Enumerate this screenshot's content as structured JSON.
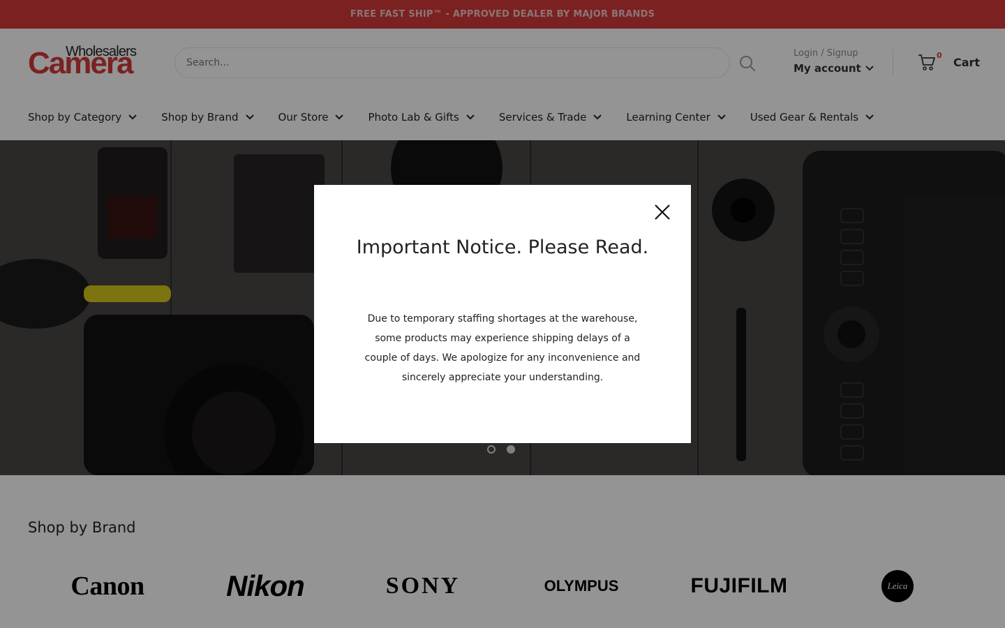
{
  "announcement": {
    "text": "FREE FAST SHIP™ - APPROVED DEALER BY MAJOR BRANDS"
  },
  "logo": {
    "top_text": "Wholesalers",
    "main_text": "Camera"
  },
  "search": {
    "placeholder": "Search..."
  },
  "account": {
    "login_label": "Login / Signup",
    "account_label": "My account"
  },
  "cart": {
    "count": "0",
    "label": "Cart"
  },
  "nav": {
    "items": [
      {
        "label": "Shop by Category"
      },
      {
        "label": "Shop by Brand"
      },
      {
        "label": "Our Store"
      },
      {
        "label": "Photo Lab & Gifts"
      },
      {
        "label": "Services & Trade"
      },
      {
        "label": "Learning Center"
      },
      {
        "label": "Used Gear & Rentals"
      }
    ]
  },
  "hero": {
    "slides_total": 2,
    "active_slide": 2
  },
  "modal": {
    "title": "Important Notice. Please Read.",
    "body": "Due to temporary staffing shortages at the warehouse, some products may experience shipping delays of a couple of days. We apologize for any inconvenience and sincerely appreciate your understanding."
  },
  "brands": {
    "title": "Shop by Brand",
    "items": [
      {
        "name": "Canon"
      },
      {
        "name": "Nikon"
      },
      {
        "name": "SONY"
      },
      {
        "name": "OLYMPUS"
      },
      {
        "name": "FUJIFILM"
      },
      {
        "name": "Leica"
      }
    ]
  },
  "colors": {
    "brand_red": "#d43a3a",
    "text": "#222222"
  },
  "icons": [
    "search-icon",
    "chevron-down-icon",
    "cart-icon",
    "close-icon"
  ]
}
